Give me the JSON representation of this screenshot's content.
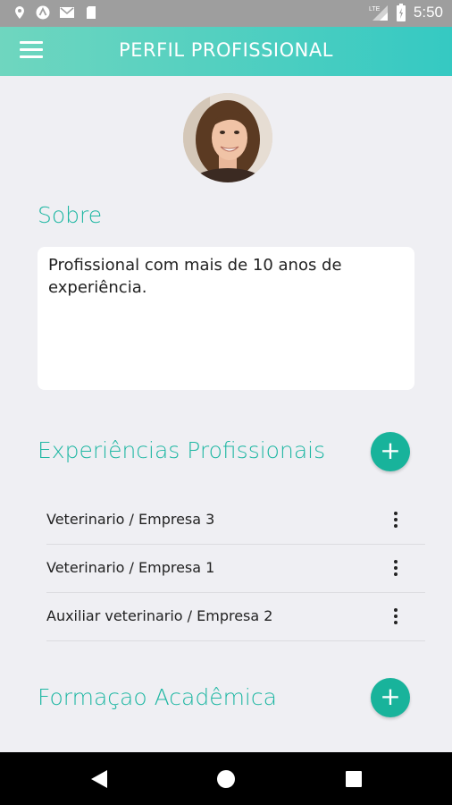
{
  "status_bar": {
    "time": "5:50",
    "network": "LTE",
    "left_icons": [
      "location-pin-icon",
      "app-icon",
      "gmail-icon",
      "sd-card-icon"
    ],
    "right_icons": [
      "signal-icon",
      "battery-icon"
    ]
  },
  "app_bar": {
    "title": "PERFIL PROFISSIONAL",
    "menu_icon": "hamburger-menu-icon"
  },
  "profile": {
    "avatar": "profile-photo"
  },
  "about": {
    "title": "Sobre",
    "text": "Profissional com mais de 10 anos de experiência."
  },
  "experiences": {
    "title": "Experiências Profissionais",
    "add_label": "+",
    "items": [
      {
        "label": "Veterinario / Empresa 3"
      },
      {
        "label": "Veterinario / Empresa 1"
      },
      {
        "label": "Auxiliar veterinario / Empresa 2"
      }
    ]
  },
  "education": {
    "title": "Formaçao Acadêmica",
    "add_label": "+"
  },
  "nav_bar": {
    "buttons": [
      "back-icon",
      "home-icon",
      "recents-icon"
    ]
  },
  "colors": {
    "accent": "#1fb7a3",
    "fab": "#18b39b",
    "appbar_start": "#6fd6bf",
    "appbar_end": "#35c9c2",
    "background": "#efeff3"
  }
}
